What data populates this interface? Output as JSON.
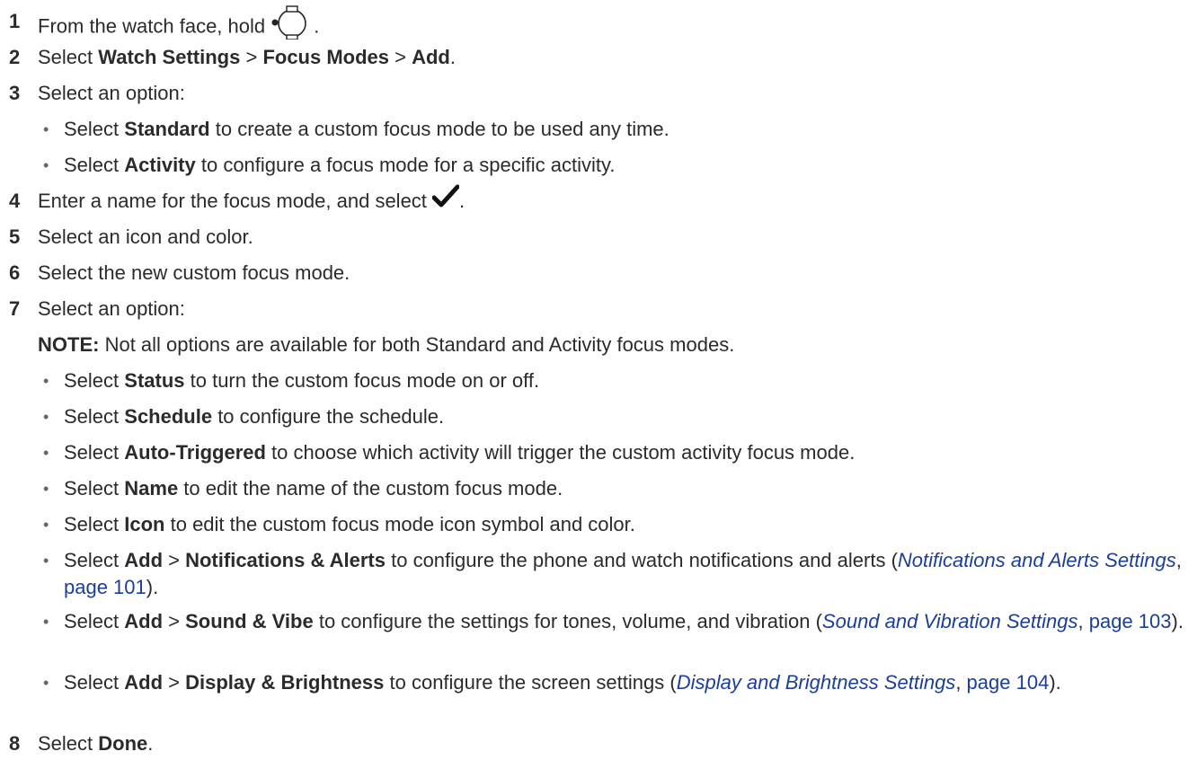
{
  "steps": {
    "s1": {
      "num": "1",
      "pre": "From the watch face, hold ",
      "post": ".",
      "icon": "button-hold-icon"
    },
    "s2": {
      "num": "2",
      "t1": "Select ",
      "b1": "Watch Settings",
      "t2": " > ",
      "b2": "Focus Modes",
      "t3": " > ",
      "b3": "Add",
      "t4": "."
    },
    "s3": {
      "num": "3",
      "text": "Select an option:"
    },
    "s3_bullets": [
      {
        "t1": "Select ",
        "b1": "Standard",
        "t2": " to create a custom focus mode to be used any time."
      },
      {
        "t1": "Select ",
        "b1": "Activity",
        "t2": " to configure a focus mode for a specific activity."
      }
    ],
    "s4": {
      "num": "4",
      "pre": "Enter a name for the focus mode, and select ",
      "post": ".",
      "icon": "checkmark-icon"
    },
    "s5": {
      "num": "5",
      "text": "Select an icon and color."
    },
    "s6": {
      "num": "6",
      "text": "Select the new custom focus mode."
    },
    "s7": {
      "num": "7",
      "text": "Select an option:"
    },
    "note": {
      "label": "NOTE:",
      "text": " Not all options are available for both Standard and Activity focus modes."
    },
    "s7_bullets": [
      {
        "t1": "Select ",
        "b1": "Status",
        "t2": " to turn the custom focus mode on or off."
      },
      {
        "t1": "Select ",
        "b1": "Schedule",
        "t2": " to configure the schedule."
      },
      {
        "t1": "Select ",
        "b1": "Auto-Triggered",
        "t2": " to choose which activity will trigger the custom activity focus mode."
      },
      {
        "t1": "Select ",
        "b1": "Name",
        "t2": " to edit the name of the custom focus mode."
      },
      {
        "t1": "Select ",
        "b1": "Icon",
        "t2": " to edit the custom focus mode icon symbol and color."
      }
    ],
    "s7_bullet_notif": {
      "t1": "Select ",
      "b1": "Add",
      "t2": " > ",
      "b2": "Notifications & Alerts",
      "t3": " to configure the phone and watch notifications and alerts (",
      "link": "Notifications and Alerts Settings",
      "t4": ", ",
      "page": "page 101",
      "t5": ")."
    },
    "s7_bullet_sound": {
      "t1": "Select ",
      "b1": "Add",
      "t2": " > ",
      "b2": "Sound & Vibe",
      "t3": " to configure the settings for tones, volume, and vibration (",
      "link": "Sound and Vibration Settings",
      "t4": ", ",
      "page": "page 103",
      "t5": ")."
    },
    "s7_bullet_display": {
      "t1": "Select ",
      "b1": "Add",
      "t2": " > ",
      "b2": "Display & Brightness",
      "t3": " to configure the screen settings (",
      "link": "Display and Brightness Settings",
      "t4": ", ",
      "page": "page 104",
      "t5": ")."
    },
    "s8": {
      "num": "8",
      "t1": "Select ",
      "b1": "Done",
      "t2": "."
    }
  },
  "colors": {
    "text": "#2b2b2b",
    "link": "#1b3f99"
  }
}
